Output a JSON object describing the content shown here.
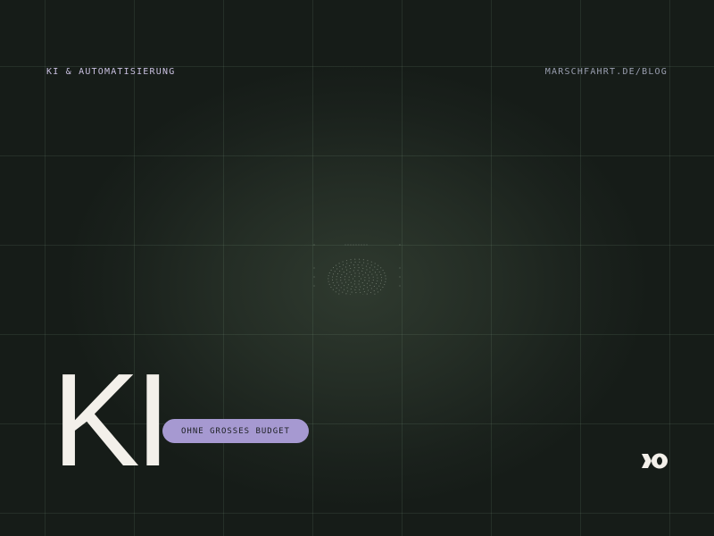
{
  "header": {
    "category": "KI & AUTOMATISIERUNG",
    "site": "MARSCHFAHRT.DE/BLOG"
  },
  "hero": {
    "title": "KI",
    "tag": "OHNE GROSSES BUDGET"
  },
  "icons": {
    "center_mark": "dotted-circle-icon",
    "brand_logo": "brand-logo-icon"
  },
  "colors": {
    "background": "#161c18",
    "glow": "#2f3a2f",
    "title": "#f3f0ea",
    "accent": "#a699d1",
    "category_text": "#c9c0e0",
    "site_text": "#9a9fb0"
  }
}
